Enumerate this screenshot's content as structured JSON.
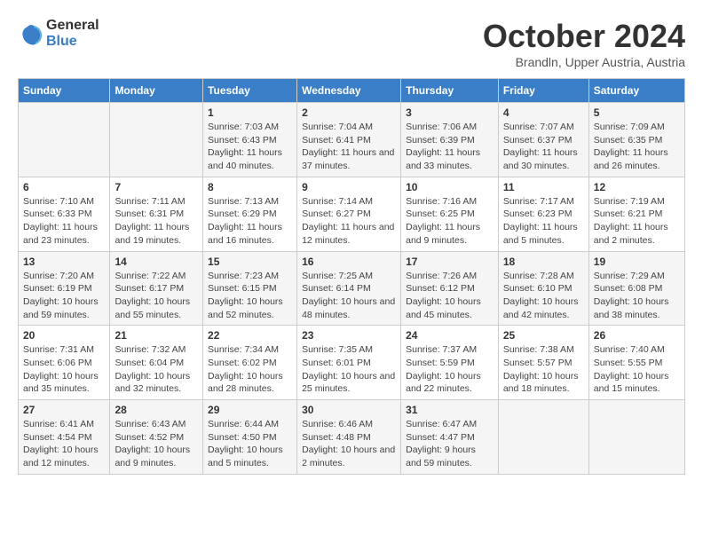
{
  "header": {
    "logo": {
      "general": "General",
      "blue": "Blue"
    },
    "title": "October 2024",
    "location": "Brandln, Upper Austria, Austria"
  },
  "calendar": {
    "days_of_week": [
      "Sunday",
      "Monday",
      "Tuesday",
      "Wednesday",
      "Thursday",
      "Friday",
      "Saturday"
    ],
    "weeks": [
      [
        {
          "day": "",
          "info": ""
        },
        {
          "day": "",
          "info": ""
        },
        {
          "day": "1",
          "info": "Sunrise: 7:03 AM\nSunset: 6:43 PM\nDaylight: 11 hours and 40 minutes."
        },
        {
          "day": "2",
          "info": "Sunrise: 7:04 AM\nSunset: 6:41 PM\nDaylight: 11 hours and 37 minutes."
        },
        {
          "day": "3",
          "info": "Sunrise: 7:06 AM\nSunset: 6:39 PM\nDaylight: 11 hours and 33 minutes."
        },
        {
          "day": "4",
          "info": "Sunrise: 7:07 AM\nSunset: 6:37 PM\nDaylight: 11 hours and 30 minutes."
        },
        {
          "day": "5",
          "info": "Sunrise: 7:09 AM\nSunset: 6:35 PM\nDaylight: 11 hours and 26 minutes."
        }
      ],
      [
        {
          "day": "6",
          "info": "Sunrise: 7:10 AM\nSunset: 6:33 PM\nDaylight: 11 hours and 23 minutes."
        },
        {
          "day": "7",
          "info": "Sunrise: 7:11 AM\nSunset: 6:31 PM\nDaylight: 11 hours and 19 minutes."
        },
        {
          "day": "8",
          "info": "Sunrise: 7:13 AM\nSunset: 6:29 PM\nDaylight: 11 hours and 16 minutes."
        },
        {
          "day": "9",
          "info": "Sunrise: 7:14 AM\nSunset: 6:27 PM\nDaylight: 11 hours and 12 minutes."
        },
        {
          "day": "10",
          "info": "Sunrise: 7:16 AM\nSunset: 6:25 PM\nDaylight: 11 hours and 9 minutes."
        },
        {
          "day": "11",
          "info": "Sunrise: 7:17 AM\nSunset: 6:23 PM\nDaylight: 11 hours and 5 minutes."
        },
        {
          "day": "12",
          "info": "Sunrise: 7:19 AM\nSunset: 6:21 PM\nDaylight: 11 hours and 2 minutes."
        }
      ],
      [
        {
          "day": "13",
          "info": "Sunrise: 7:20 AM\nSunset: 6:19 PM\nDaylight: 10 hours and 59 minutes."
        },
        {
          "day": "14",
          "info": "Sunrise: 7:22 AM\nSunset: 6:17 PM\nDaylight: 10 hours and 55 minutes."
        },
        {
          "day": "15",
          "info": "Sunrise: 7:23 AM\nSunset: 6:15 PM\nDaylight: 10 hours and 52 minutes."
        },
        {
          "day": "16",
          "info": "Sunrise: 7:25 AM\nSunset: 6:14 PM\nDaylight: 10 hours and 48 minutes."
        },
        {
          "day": "17",
          "info": "Sunrise: 7:26 AM\nSunset: 6:12 PM\nDaylight: 10 hours and 45 minutes."
        },
        {
          "day": "18",
          "info": "Sunrise: 7:28 AM\nSunset: 6:10 PM\nDaylight: 10 hours and 42 minutes."
        },
        {
          "day": "19",
          "info": "Sunrise: 7:29 AM\nSunset: 6:08 PM\nDaylight: 10 hours and 38 minutes."
        }
      ],
      [
        {
          "day": "20",
          "info": "Sunrise: 7:31 AM\nSunset: 6:06 PM\nDaylight: 10 hours and 35 minutes."
        },
        {
          "day": "21",
          "info": "Sunrise: 7:32 AM\nSunset: 6:04 PM\nDaylight: 10 hours and 32 minutes."
        },
        {
          "day": "22",
          "info": "Sunrise: 7:34 AM\nSunset: 6:02 PM\nDaylight: 10 hours and 28 minutes."
        },
        {
          "day": "23",
          "info": "Sunrise: 7:35 AM\nSunset: 6:01 PM\nDaylight: 10 hours and 25 minutes."
        },
        {
          "day": "24",
          "info": "Sunrise: 7:37 AM\nSunset: 5:59 PM\nDaylight: 10 hours and 22 minutes."
        },
        {
          "day": "25",
          "info": "Sunrise: 7:38 AM\nSunset: 5:57 PM\nDaylight: 10 hours and 18 minutes."
        },
        {
          "day": "26",
          "info": "Sunrise: 7:40 AM\nSunset: 5:55 PM\nDaylight: 10 hours and 15 minutes."
        }
      ],
      [
        {
          "day": "27",
          "info": "Sunrise: 6:41 AM\nSunset: 4:54 PM\nDaylight: 10 hours and 12 minutes."
        },
        {
          "day": "28",
          "info": "Sunrise: 6:43 AM\nSunset: 4:52 PM\nDaylight: 10 hours and 9 minutes."
        },
        {
          "day": "29",
          "info": "Sunrise: 6:44 AM\nSunset: 4:50 PM\nDaylight: 10 hours and 5 minutes."
        },
        {
          "day": "30",
          "info": "Sunrise: 6:46 AM\nSunset: 4:48 PM\nDaylight: 10 hours and 2 minutes."
        },
        {
          "day": "31",
          "info": "Sunrise: 6:47 AM\nSunset: 4:47 PM\nDaylight: 9 hours and 59 minutes."
        },
        {
          "day": "",
          "info": ""
        },
        {
          "day": "",
          "info": ""
        }
      ]
    ]
  }
}
